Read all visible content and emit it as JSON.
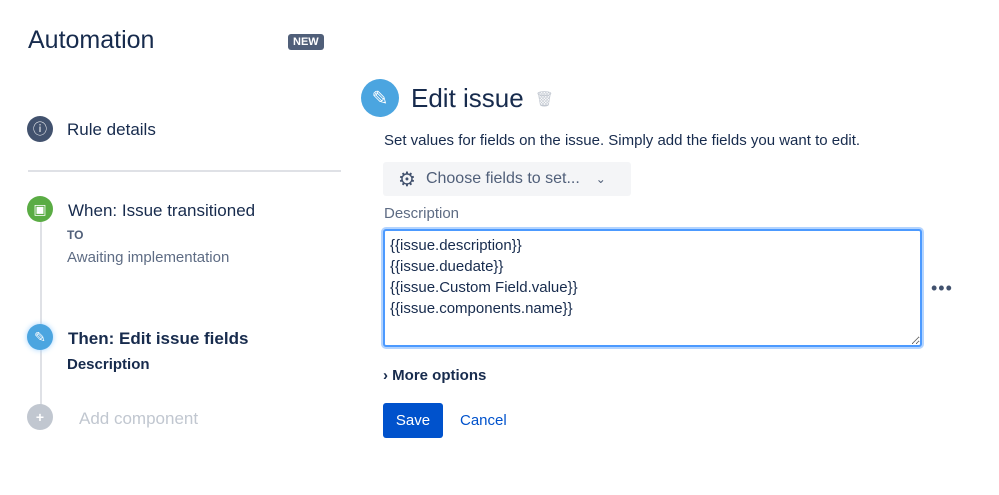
{
  "header": {
    "title": "Automation",
    "badge": "NEW"
  },
  "sidebar": {
    "rule_details": "Rule details",
    "trigger": {
      "title": "When: Issue transitioned",
      "label": "TO",
      "value": "Awaiting implementation"
    },
    "action": {
      "title": "Then: Edit issue fields",
      "subtitle": "Description"
    },
    "add_component": "Add component"
  },
  "main": {
    "title": "Edit issue",
    "description": "Set values for fields on the issue. Simply add the fields you want to edit.",
    "choose_fields": "Choose fields to set...",
    "field_label": "Description",
    "field_value": "{{issue.description}}\n{{issue.duedate}}\n{{issue.Custom Field.value}}\n{{issue.components.name}}",
    "more_options": "More options",
    "save": "Save",
    "cancel": "Cancel"
  }
}
